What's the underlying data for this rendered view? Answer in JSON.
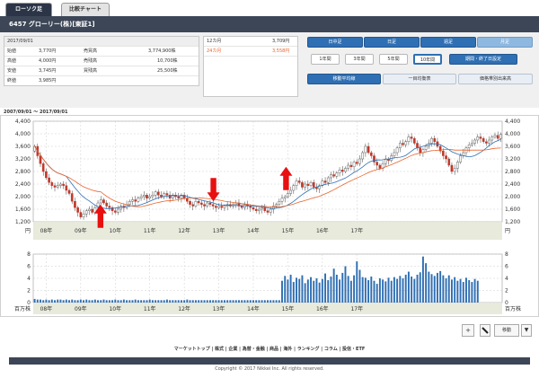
{
  "tabs": [
    {
      "label": "ローソク足",
      "active": true
    },
    {
      "label": "比較チャート",
      "active": false
    }
  ],
  "header": {
    "title": "6457 グローリー(株)[東証1]"
  },
  "info": {
    "date": "2017/09/01",
    "rows": [
      {
        "label": "始値",
        "value": "3,770円",
        "label2": "売買高",
        "value2": "3,774,900株"
      },
      {
        "label": "高値",
        "value": "4,000円",
        "label2": "売残高",
        "value2": "10,700株"
      },
      {
        "label": "安値",
        "value": "3,745円",
        "label2": "買残高",
        "value2": "25,500株"
      },
      {
        "label": "終値",
        "value": "3,985円",
        "label2": "",
        "value2": ""
      }
    ]
  },
  "ma_box": {
    "rows": [
      {
        "label": "12カ月",
        "value": "3,709円",
        "color": "#333333"
      },
      {
        "label": "24カ月",
        "value": "3,558円",
        "color": "#e8632c"
      }
    ]
  },
  "controls": {
    "interval_buttons": [
      "日中足",
      "日足",
      "週足",
      "月足"
    ],
    "interval_selected": "月足",
    "range_buttons": [
      "1年間",
      "3年間",
      "5年間",
      "10年間"
    ],
    "range_selected": "10年間",
    "period_button": "期間・終了日設定",
    "bottom_buttons": [
      "移動平均線",
      "一目均衡表",
      "価格帯別出来高"
    ]
  },
  "date_range": "2007/09/01 ～ 2017/09/01",
  "chart_data": [
    {
      "type": "candlestick",
      "title": "",
      "xlabel": "",
      "ylabel": "円",
      "ylim": [
        1200,
        4400
      ],
      "y_ticks": [
        1200,
        1600,
        2000,
        2400,
        2800,
        3200,
        3600,
        4000,
        4400
      ],
      "x_ticks": [
        "08年",
        "09年",
        "10年",
        "11年",
        "12年",
        "13年",
        "14年",
        "15年",
        "16年",
        "17年"
      ],
      "unit_label": "円",
      "grid": true,
      "up_color": "#ffffff",
      "down_color": "#c0392b",
      "close": [
        3600,
        3300,
        3050,
        2800,
        2600,
        2450,
        2350,
        2300,
        2350,
        2400,
        2350,
        2200,
        2100,
        1850,
        1650,
        1500,
        1350,
        1450,
        1550,
        1600,
        1500,
        1650,
        1800,
        1900,
        1800,
        1700,
        1650,
        1550,
        1500,
        1600,
        1700,
        1650,
        1750,
        1850,
        1900,
        1850,
        1950,
        2000,
        2050,
        1950,
        2000,
        2050,
        2150,
        2050,
        2000,
        2100,
        2050,
        1950,
        2050,
        2000,
        1950,
        2050,
        1950,
        1850,
        1750,
        1700,
        1850,
        1800,
        1750,
        1700,
        1800,
        1750,
        1700,
        1650,
        1700,
        1650,
        1700,
        1750,
        1700,
        1750,
        1800,
        1700,
        1650,
        1750,
        1700,
        1650,
        1600,
        1550,
        1600,
        1650,
        1550,
        1500,
        1600,
        1700,
        1750,
        1850,
        1950,
        2000,
        2100,
        2200,
        2350,
        2500,
        2450,
        2300,
        2400,
        2350,
        2450,
        2300,
        2250,
        2350,
        2500,
        2450,
        2600,
        2700,
        2650,
        2750,
        2850,
        2800,
        2900,
        3000,
        2950,
        3100,
        3050,
        3200,
        3400,
        3600,
        3400,
        3300,
        3100,
        3000,
        2900,
        3050,
        3200,
        3150,
        3300,
        3400,
        3550,
        3700,
        3650,
        3750,
        3900,
        3850,
        3700,
        3550,
        3400,
        3500,
        3600,
        3700,
        3850,
        3750,
        3600,
        3450,
        3300,
        3200,
        3000,
        2800,
        2900,
        3100,
        3300,
        3400,
        3550,
        3650,
        3700,
        3800,
        3900,
        3850,
        3750,
        3700,
        3800,
        3900,
        3950,
        3850,
        3985
      ],
      "ma": [
        {
          "name": "12カ月",
          "color": "#2f6fb3"
        },
        {
          "name": "24カ月",
          "color": "#e8632c"
        }
      ],
      "annotations": [
        {
          "type": "arrow-up",
          "at": "09年"
        },
        {
          "type": "arrow-down",
          "at": "13年"
        },
        {
          "type": "arrow-up",
          "at": "15年"
        }
      ]
    },
    {
      "type": "bar",
      "title": "",
      "ylabel": "百万株",
      "unit_label": "百万株",
      "ylim": [
        0,
        8
      ],
      "y_ticks": [
        0,
        2,
        4,
        6,
        8
      ],
      "x_ticks": [
        "08年",
        "09年",
        "10年",
        "11年",
        "12年",
        "13年",
        "14年",
        "15年",
        "16年",
        "17年"
      ],
      "bar_color": "#2f6fb3",
      "values": [
        0.6,
        0.5,
        0.5,
        0.4,
        0.5,
        0.4,
        0.5,
        0.4,
        0.5,
        0.5,
        0.4,
        0.5,
        0.4,
        0.5,
        0.4,
        0.4,
        0.5,
        0.4,
        0.5,
        0.4,
        0.4,
        0.5,
        0.4,
        0.4,
        0.5,
        0.4,
        0.4,
        0.4,
        0.5,
        0.4,
        0.4,
        0.5,
        0.4,
        0.4,
        0.4,
        0.5,
        0.4,
        0.4,
        0.4,
        0.4,
        0.5,
        0.4,
        0.4,
        0.4,
        0.4,
        0.4,
        0.5,
        0.4,
        0.4,
        0.4,
        0.4,
        0.4,
        0.4,
        0.5,
        0.4,
        0.4,
        0.4,
        0.4,
        0.4,
        0.4,
        0.4,
        0.4,
        0.4,
        0.4,
        0.4,
        0.4,
        0.4,
        0.4,
        0.4,
        0.4,
        0.4,
        0.4,
        0.4,
        0.4,
        0.4,
        0.4,
        0.4,
        0.4,
        0.4,
        0.4,
        0.4,
        0.4,
        0.4,
        0.4,
        0.4,
        0.4,
        3.6,
        4.4,
        3.8,
        4.6,
        3.4,
        4.1,
        3.9,
        4.5,
        3.2,
        3.8,
        4.2,
        3.6,
        4.0,
        3.3,
        3.9,
        4.8,
        3.7,
        4.3,
        5.6,
        4.6,
        3.8,
        4.9,
        6.0,
        4.4,
        3.6,
        4.5,
        6.8,
        5.4,
        4.2,
        4.1,
        3.7,
        4.3,
        3.6,
        3.1,
        4.0,
        3.8,
        3.5,
        4.1,
        3.6,
        4.2,
        3.9,
        4.4,
        4.0,
        4.6,
        5.1,
        4.3,
        3.9,
        4.6,
        5.0,
        7.6,
        6.5,
        5.1,
        4.7,
        4.4,
        4.9,
        5.2,
        4.5,
        4.0,
        4.5,
        3.8,
        4.2,
        3.6,
        3.9,
        3.4,
        4.1,
        3.7,
        3.4,
        3.9,
        3.6
      ]
    }
  ],
  "tools": {
    "plus": "+",
    "move_label": "移動",
    "dropdown": "▼"
  },
  "footer": {
    "links": [
      "マーケットトップ",
      "株式",
      "企業",
      "為替・金融",
      "商品",
      "海外",
      "ランキング",
      "コラム",
      "投信・ETF"
    ],
    "separator": " | ",
    "copyright": "Copyright © 2017 Nikkei Inc. All rights reserved."
  }
}
